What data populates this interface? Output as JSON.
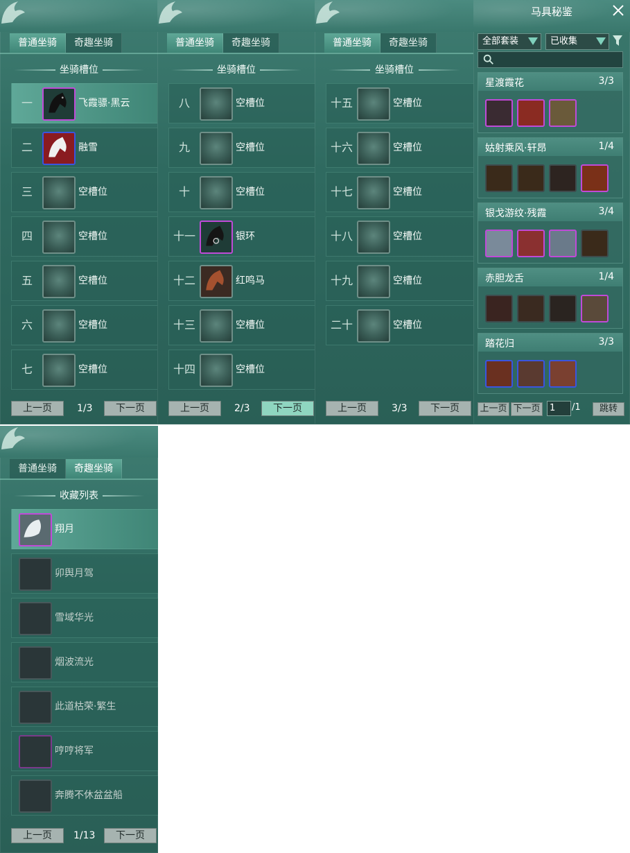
{
  "tabs": {
    "normal": "普通坐骑",
    "fun": "奇趣坐骑"
  },
  "section_slots": "坐骑槽位",
  "section_collection": "收藏列表",
  "pager": {
    "prev": "上一页",
    "next": "下一页"
  },
  "page1": {
    "page": "1/3",
    "rows": [
      {
        "num": "一",
        "name": "飞霞骠·黑云",
        "icon": "black-horse-icon"
      },
      {
        "num": "二",
        "name": "融雪",
        "icon": "white-horse-icon"
      },
      {
        "num": "三",
        "name": "空槽位",
        "icon": "empty-slot-icon"
      },
      {
        "num": "四",
        "name": "空槽位",
        "icon": "empty-slot-icon"
      },
      {
        "num": "五",
        "name": "空槽位",
        "icon": "empty-slot-icon"
      },
      {
        "num": "六",
        "name": "空槽位",
        "icon": "empty-slot-icon"
      },
      {
        "num": "七",
        "name": "空槽位",
        "icon": "empty-slot-icon"
      }
    ]
  },
  "page2": {
    "page": "2/3",
    "rows": [
      {
        "num": "八",
        "name": "空槽位"
      },
      {
        "num": "九",
        "name": "空槽位"
      },
      {
        "num": "十",
        "name": "空槽位"
      },
      {
        "num": "十一",
        "name": "银环"
      },
      {
        "num": "十二",
        "name": "红鸣马"
      },
      {
        "num": "十三",
        "name": "空槽位"
      },
      {
        "num": "十四",
        "name": "空槽位"
      }
    ]
  },
  "page3": {
    "page": "3/3",
    "rows": [
      {
        "num": "十五",
        "name": "空槽位"
      },
      {
        "num": "十六",
        "name": "空槽位"
      },
      {
        "num": "十七",
        "name": "空槽位"
      },
      {
        "num": "十八",
        "name": "空槽位"
      },
      {
        "num": "十九",
        "name": "空槽位"
      },
      {
        "num": "二十",
        "name": "空槽位"
      }
    ]
  },
  "collection": {
    "page": "1/13",
    "rows": [
      {
        "name": "翔月"
      },
      {
        "name": "卯舆月驾"
      },
      {
        "name": "雪域华光"
      },
      {
        "name": "烟波流光"
      },
      {
        "name": "此道枯荣·繁生"
      },
      {
        "name": "哼哼将军"
      },
      {
        "name": "奔腾不休盆盆船"
      }
    ]
  },
  "harness": {
    "title": "马具秘鉴",
    "filter_set": "全部套装",
    "filter_state": "已收集",
    "groups": [
      {
        "name": "星渡霞花",
        "count": "3/3"
      },
      {
        "name": "姑射乘风·轩昂",
        "count": "1/4"
      },
      {
        "name": "银戈游纹·残霞",
        "count": "3/4"
      },
      {
        "name": "赤胆龙舌",
        "count": "1/4"
      },
      {
        "name": "踏花归",
        "count": "3/3"
      }
    ],
    "page_input": "1",
    "page_total": "/1",
    "jump": "跳转"
  }
}
